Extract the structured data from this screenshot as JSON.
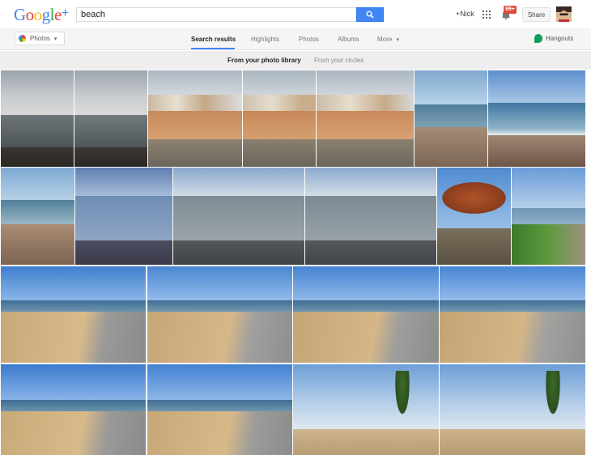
{
  "header": {
    "logo_text": "Google",
    "logo_plus": "+",
    "search_value": "beach",
    "user_label": "+Nick",
    "notification_count": "99+",
    "share_label": "Share"
  },
  "nav": {
    "photos_dropdown_label": "Photos",
    "tabs": [
      {
        "label": "Search results"
      },
      {
        "label": "Highlights"
      },
      {
        "label": "Photos"
      },
      {
        "label": "Albums"
      },
      {
        "label": "More"
      }
    ],
    "hangouts_label": "Hangouts"
  },
  "sources": {
    "library_label": "From your photo library",
    "circles_label": "From your circles"
  },
  "colors": {
    "accent": "#4285f4",
    "badge": "#dd4b39",
    "hangouts": "#0f9d58"
  }
}
